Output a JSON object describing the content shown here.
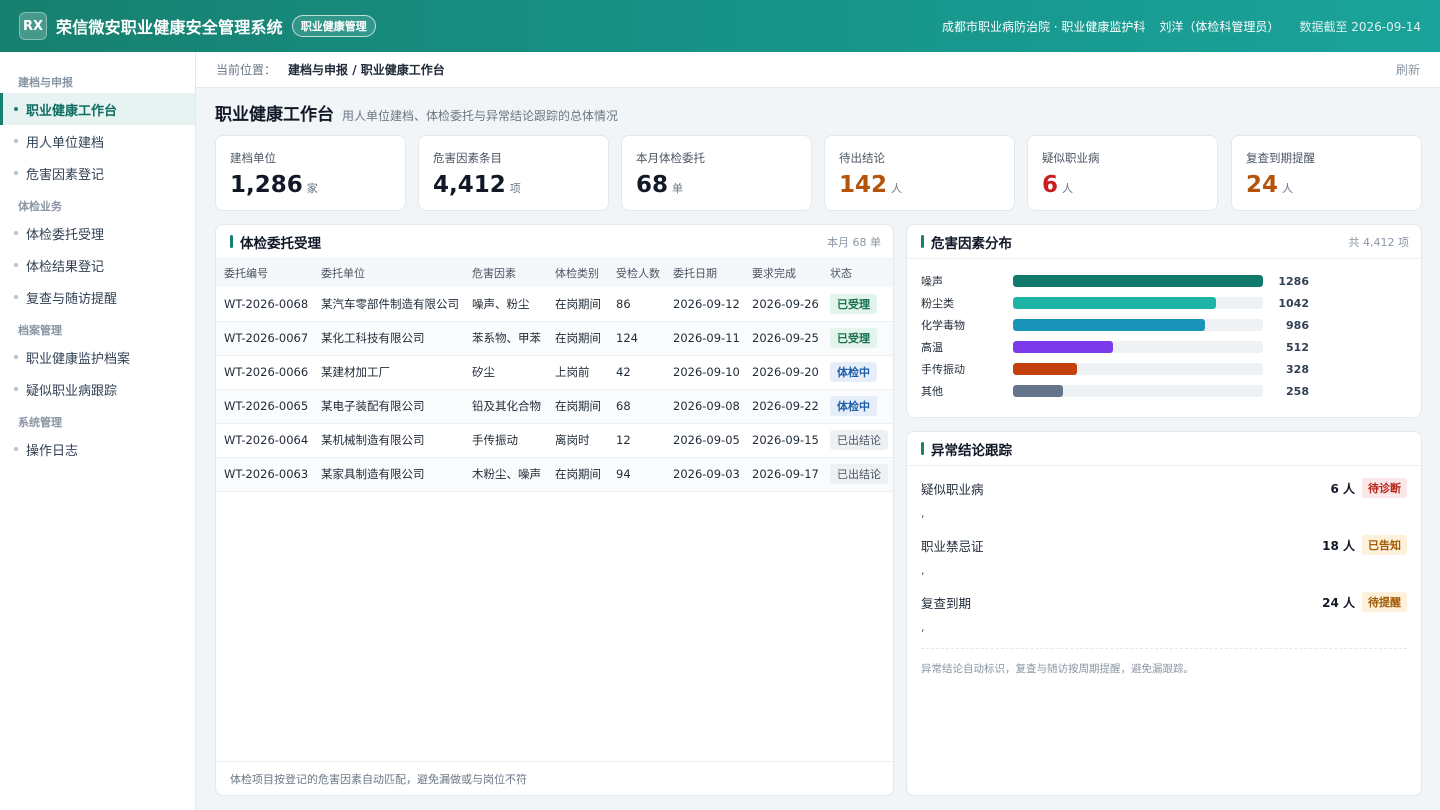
{
  "topbar": {
    "logo": "RX",
    "title": "荣信微安职业健康安全管理系统",
    "module_badge": "职业健康管理",
    "org": "成都市职业病防治院 · 职业健康监护科",
    "user": "刘洋（体检科管理员）",
    "as_of": "数据截至 2026-09-14"
  },
  "sidebar": {
    "groups": [
      {
        "label": "建档与申报",
        "items": [
          "职业健康工作台",
          "用人单位建档",
          "危害因素登记"
        ]
      },
      {
        "label": "体检业务",
        "items": [
          "体检委托受理",
          "体检结果登记",
          "复查与随访提醒"
        ]
      },
      {
        "label": "档案管理",
        "items": [
          "职业健康监护档案",
          "疑似职业病跟踪"
        ]
      },
      {
        "label": "系统管理",
        "items": [
          "操作日志"
        ]
      }
    ],
    "active_item": "职业健康工作台"
  },
  "breadcrumb": {
    "label": "当前位置：",
    "path": "建档与申报 / 职业健康工作台",
    "refresh": "刷新"
  },
  "page": {
    "title": "职业健康工作台",
    "subtitle": "用人单位建档、体检委托与异常结论跟踪的总体情况"
  },
  "kpis": [
    {
      "label": "建档单位",
      "value": "1,286",
      "unit": "家",
      "color": "#111827"
    },
    {
      "label": "危害因素条目",
      "value": "4,412",
      "unit": "项",
      "color": "#111827"
    },
    {
      "label": "本月体检委托",
      "value": "68",
      "unit": "单",
      "color": "#111827"
    },
    {
      "label": "待出结论",
      "value": "142",
      "unit": "人",
      "color": "#b45309"
    },
    {
      "label": "疑似职业病",
      "value": "6",
      "unit": "人",
      "color": "#c81e1e"
    },
    {
      "label": "复查到期提醒",
      "value": "24",
      "unit": "人",
      "color": "#b45309"
    }
  ],
  "commission": {
    "title": "体检委托受理",
    "meta": "本月 68 单",
    "columns": [
      "委托编号",
      "委托单位",
      "危害因素",
      "体检类别",
      "受检人数",
      "委托日期",
      "要求完成",
      "状态"
    ],
    "rows": [
      {
        "id": "WT-2026-0068",
        "unit": "某汽车零部件制造有限公司",
        "hazard": "噪声、粉尘",
        "type": "在岗期间",
        "count": "86",
        "date": "2026-09-12",
        "due": "2026-09-26",
        "status": "已受理",
        "status_style": "green"
      },
      {
        "id": "WT-2026-0067",
        "unit": "某化工科技有限公司",
        "hazard": "苯系物、甲苯",
        "type": "在岗期间",
        "count": "124",
        "date": "2026-09-11",
        "due": "2026-09-25",
        "status": "已受理",
        "status_style": "green"
      },
      {
        "id": "WT-2026-0066",
        "unit": "某建材加工厂",
        "hazard": "矽尘",
        "type": "上岗前",
        "count": "42",
        "date": "2026-09-10",
        "due": "2026-09-20",
        "status": "体检中",
        "status_style": "blue"
      },
      {
        "id": "WT-2026-0065",
        "unit": "某电子装配有限公司",
        "hazard": "铅及其化合物",
        "type": "在岗期间",
        "count": "68",
        "date": "2026-09-08",
        "due": "2026-09-22",
        "status": "体检中",
        "status_style": "blue"
      },
      {
        "id": "WT-2026-0064",
        "unit": "某机械制造有限公司",
        "hazard": "手传振动",
        "type": "离岗时",
        "count": "12",
        "date": "2026-09-05",
        "due": "2026-09-15",
        "status": "已出结论",
        "status_style": "gray"
      },
      {
        "id": "WT-2026-0063",
        "unit": "某家具制造有限公司",
        "hazard": "木粉尘、噪声",
        "type": "在岗期间",
        "count": "94",
        "date": "2026-09-03",
        "due": "2026-09-17",
        "status": "已出结论",
        "status_style": "gray"
      }
    ],
    "footer": "体检项目按登记的危害因素自动匹配，避免漏做或与岗位不符"
  },
  "chart_data": {
    "type": "bar",
    "title": "危害因素分布",
    "meta": "共 4,412 项",
    "categories": [
      "噪声",
      "粉尘类",
      "化学毒物",
      "高温",
      "手传振动",
      "其他"
    ],
    "values": [
      1286,
      1042,
      986,
      512,
      328,
      258
    ],
    "colors": [
      "#127a6d",
      "#1fb5a6",
      "#1a93b8",
      "#7c3aed",
      "#c2410c",
      "#64748b"
    ],
    "xlim": [
      0,
      1286
    ],
    "orientation": "horizontal"
  },
  "abnormal": {
    "title": "异常结论跟踪",
    "items": [
      {
        "name": "疑似职业病",
        "count": "6 人",
        "tag": "待诊断",
        "tag_style": "red"
      },
      {
        "name": "职业禁忌证",
        "count": "18 人",
        "tag": "已告知",
        "tag_style": "amber"
      },
      {
        "name": "复查到期",
        "count": "24 人",
        "tag": "待提醒",
        "tag_style": "amber"
      }
    ],
    "separator": ",",
    "note": "异常结论自动标识，复查与随访按周期提醒，避免漏跟踪。"
  }
}
